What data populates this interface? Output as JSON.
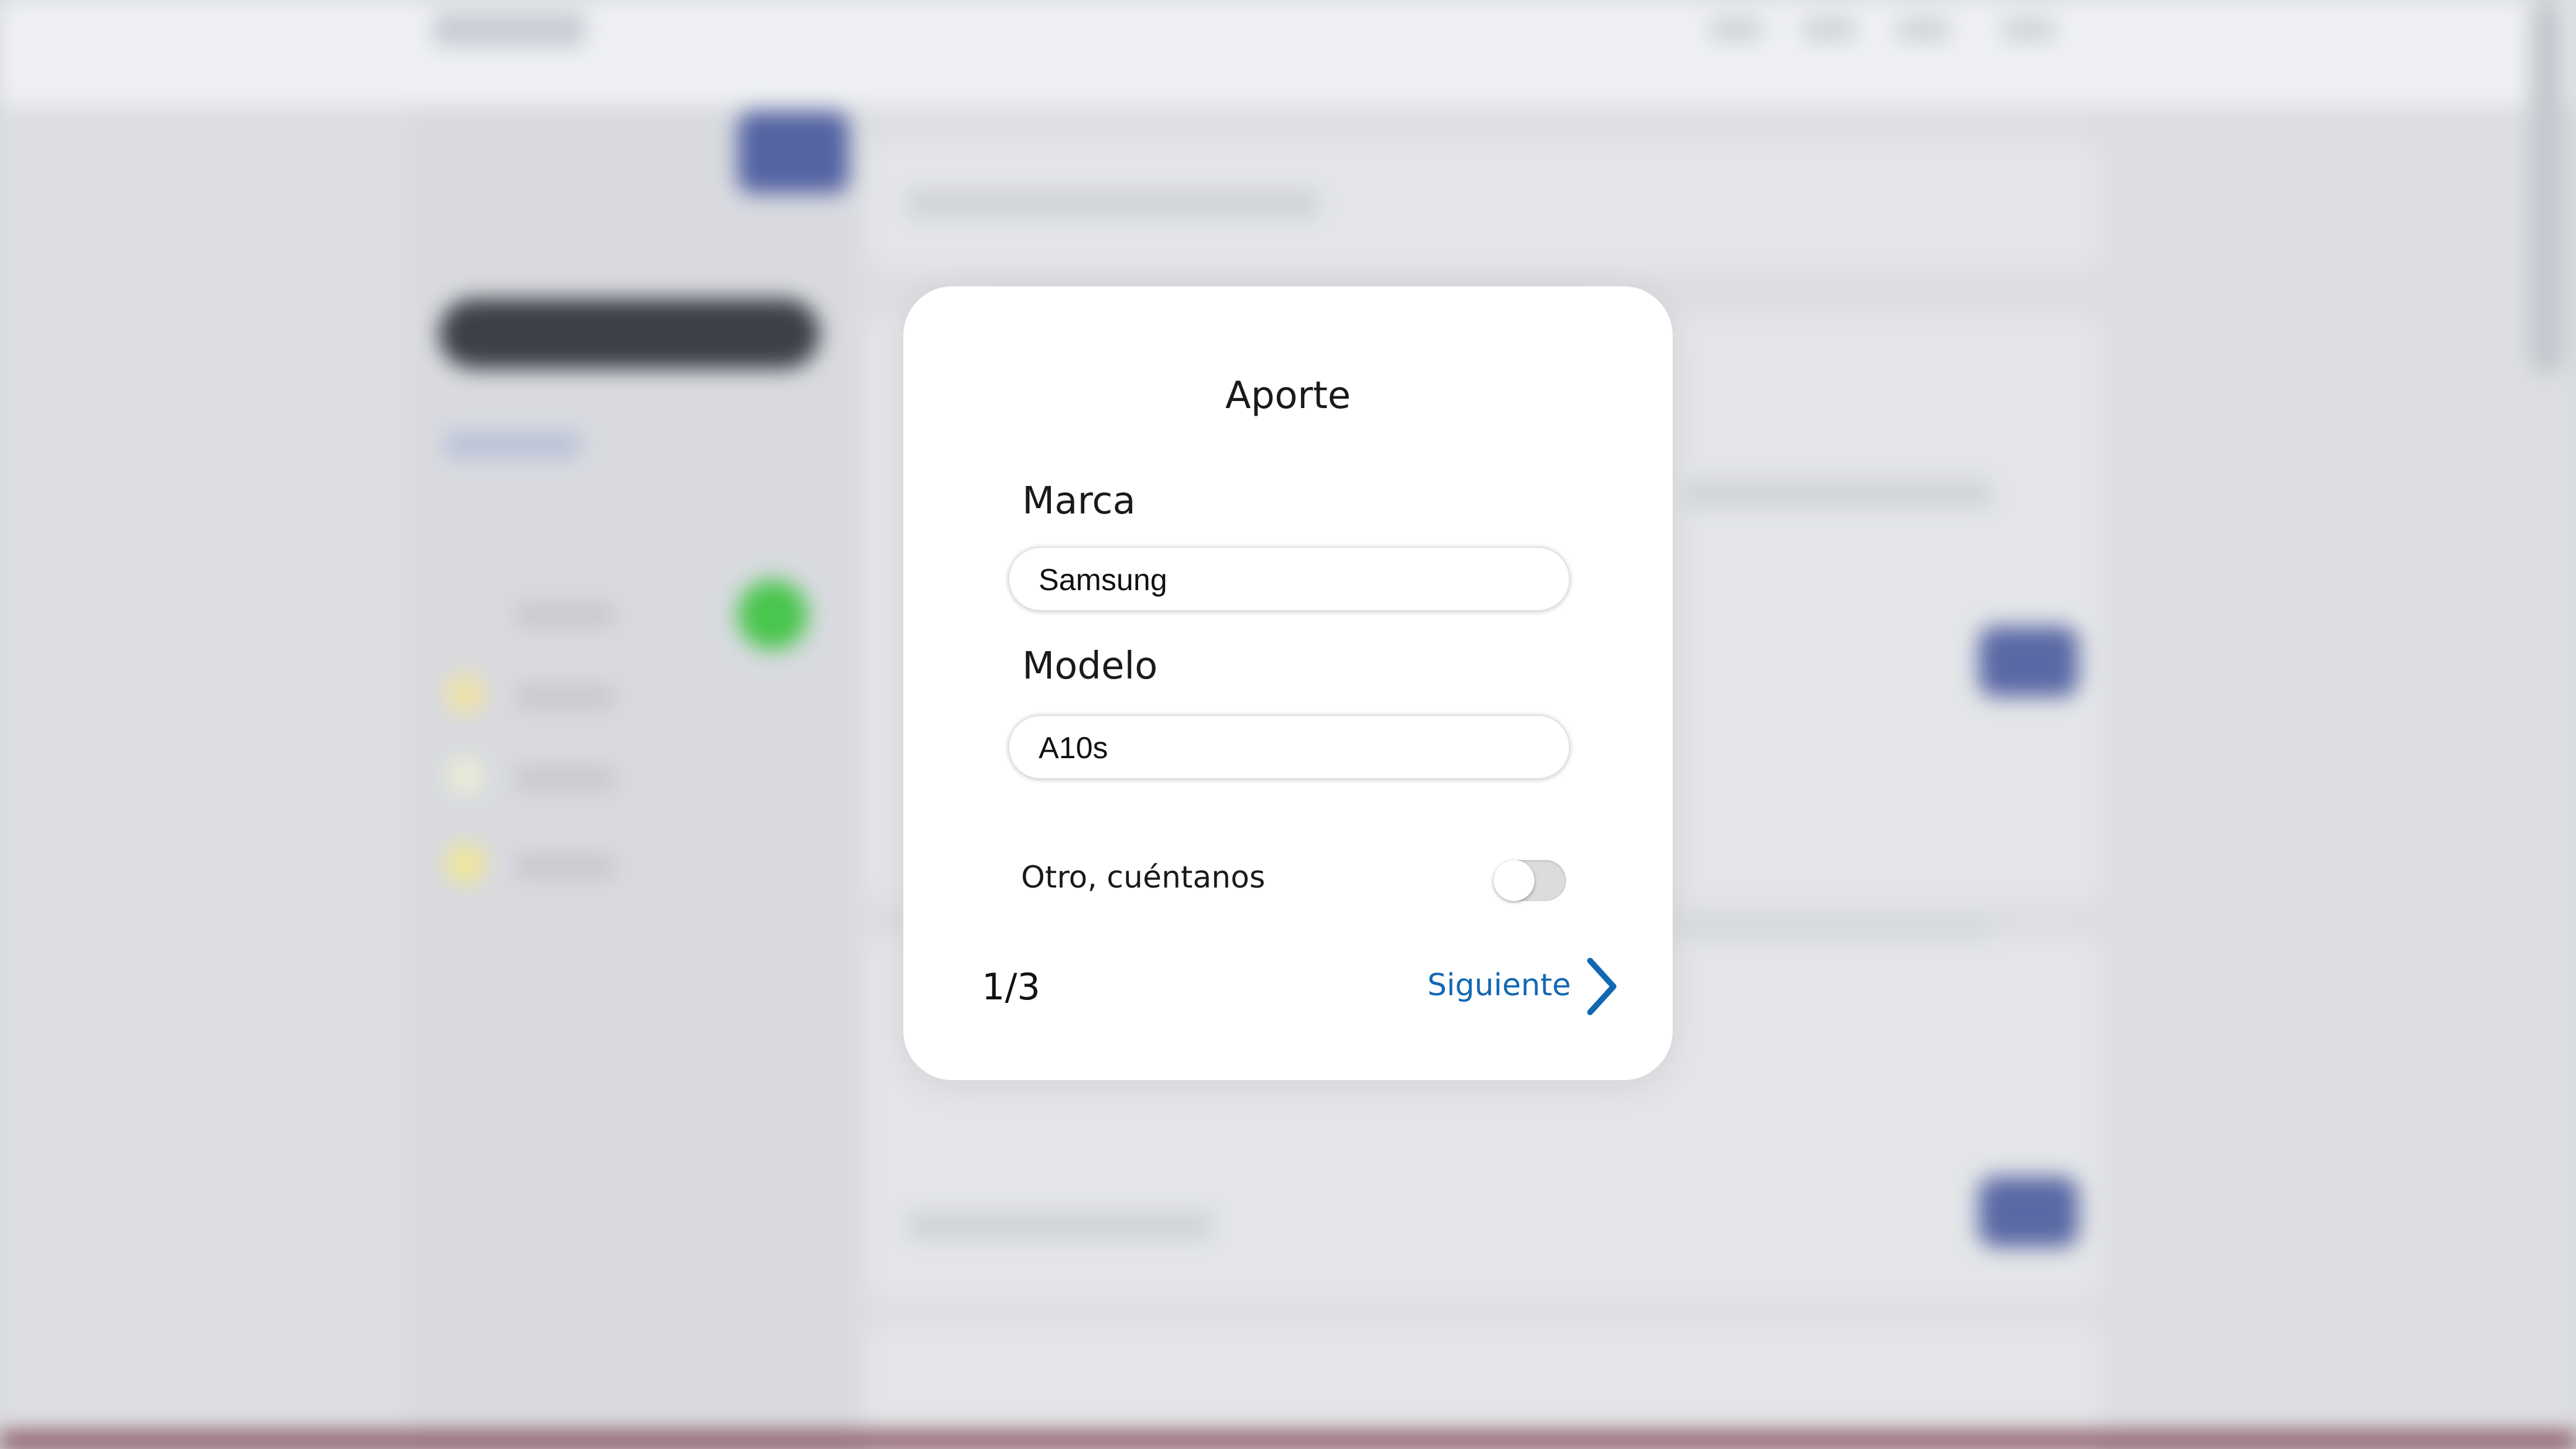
{
  "modal": {
    "title": "Aporte",
    "fields": [
      {
        "label": "Marca",
        "value": "Samsung"
      },
      {
        "label": "Modelo",
        "value": "A10s"
      }
    ],
    "toggle": {
      "label": "Otro, cuéntanos",
      "checked": false
    },
    "pager": "1/3",
    "next_label": "Siguiente",
    "icons": {
      "next": "chevron-right-icon"
    },
    "colors": {
      "accent": "#1268b3",
      "background_overlay": "#d6d8dc"
    }
  }
}
